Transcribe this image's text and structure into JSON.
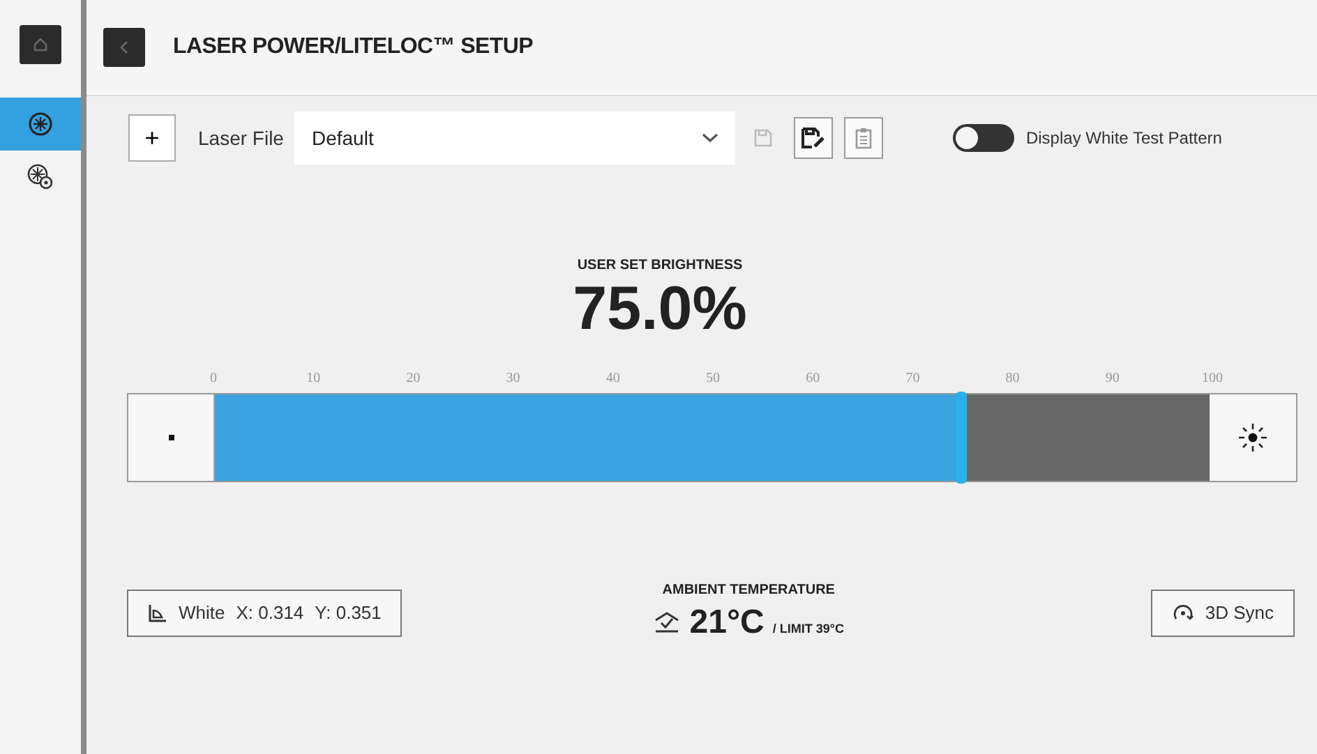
{
  "sidebar": {
    "items": [
      {
        "kind": "laser",
        "selected": true
      },
      {
        "kind": "laser-settings",
        "selected": false
      }
    ]
  },
  "header": {
    "title": "LASER POWER/LITELOC™ SETUP"
  },
  "toolbar": {
    "add": "+",
    "file_label": "Laser File",
    "file_value": "Default",
    "toggle": {
      "label": "Display White Test Pattern",
      "on": false
    }
  },
  "brightness": {
    "label": "USER SET BRIGHTNESS",
    "value": "75.0%",
    "level": 0.75,
    "ticks": [
      "0",
      "10",
      "20",
      "30",
      "40",
      "50",
      "60",
      "70",
      "80",
      "90",
      "100"
    ]
  },
  "white_point": {
    "label": "White",
    "x": "X: 0.314",
    "y": "Y: 0.351"
  },
  "temperature": {
    "label": "AMBIENT TEMPERATURE",
    "value": "21°C",
    "limit": "/ LIMIT 39°C"
  },
  "sync": {
    "label": "3D Sync"
  }
}
